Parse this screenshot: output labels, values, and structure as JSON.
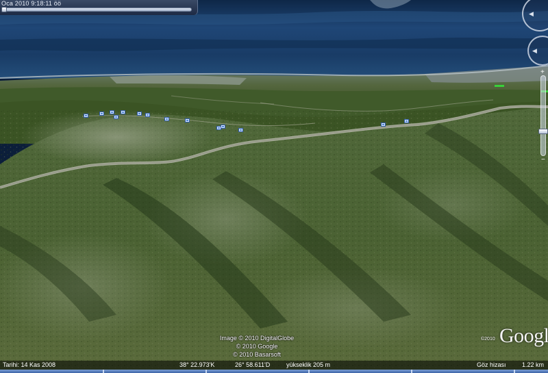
{
  "time_slider": {
    "label": "Oca 2010   9:18:11 öö"
  },
  "attribution": {
    "lines": [
      "Image © 2010 DigitalGlobe",
      "© 2010 Google",
      "© 2010 Basarsoft"
    ]
  },
  "logo": {
    "copyright": "©2010",
    "text": "Google"
  },
  "status_bar": {
    "imagery_date": "Tarihi: 14 Kas 2008",
    "latitude": "38° 22.973'K",
    "longitude": "26° 58.611'D",
    "elevation": "yükseklik  205 m",
    "eye_altitude_label": "Göz hizası",
    "eye_altitude_value": "1.22 km"
  },
  "navigation": {
    "look_icon": "look-around-icon",
    "move_icon": "move-icon",
    "zoom_in": "+",
    "zoom_out": "−"
  },
  "colors": {
    "sea": "#1b3f6b",
    "forest": "#3f5826",
    "road": "#a9aca1",
    "placemark": "#4f86d8"
  }
}
